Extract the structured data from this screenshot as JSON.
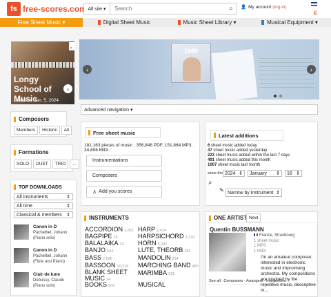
{
  "header": {
    "logo_mark": "fs",
    "logo_text": "free-scores.com",
    "search_scope": "All site ▾",
    "search_placeholder": "Search",
    "account_label": "My account",
    "account_login": "(log-in)",
    "currency": "€"
  },
  "nav": [
    {
      "label": "Free Sheet Music ▾"
    },
    {
      "label": "Digital Sheet Music"
    },
    {
      "label": "Music Sheet Library ▾"
    },
    {
      "label": "Musical Equipment ▾"
    }
  ],
  "ad": {
    "title": "Longy School of Music",
    "deadline": "Deadline: Jan. 5, 2024",
    "badge": "i ✕"
  },
  "carousel": {
    "album_text": "1989"
  },
  "composers": {
    "title": "Composers",
    "buttons": [
      "Members",
      "Historic",
      "All"
    ]
  },
  "formations": {
    "title": "Formations",
    "buttons": [
      "SOLO",
      "DUET",
      "TRIO",
      "..."
    ]
  },
  "top_downloads": {
    "title": "TOP DOWNLOADS",
    "selects": [
      "All instruments",
      "All time",
      "Classical & members"
    ],
    "items": [
      {
        "title": "Canon in D",
        "sub": "Pachelbel, Johann (Piano solo)"
      },
      {
        "title": "Canon in D",
        "sub": "Pachelbel, Johann (Flute and Piano)"
      },
      {
        "title": "Clair de lune",
        "sub": "Debussy, Claude (Piano solo)"
      }
    ]
  },
  "advanced_nav": "Advanced navigation ▾",
  "free_sheet": {
    "title": "Free sheet music",
    "stats_line1": "181,163 pieces of music : 356,848 PDF, 151,864 MP3,",
    "stats_line2": "34,806 MIDI.",
    "buttons": [
      "Instrumentations",
      "Composers",
      "Add you scores"
    ]
  },
  "latest": {
    "title": "Latest additions",
    "lines": [
      {
        "num": "6",
        "text": " sheet music added today"
      },
      {
        "num": "47",
        "text": " sheet music added yesterday"
      },
      {
        "num": "223",
        "text": " sheet music added within the last 7 days"
      },
      {
        "num": "491",
        "text": " sheet music added this month"
      },
      {
        "num": "1007",
        "text": " sheet music last month"
      }
    ],
    "since_label": "since the",
    "year": "2024",
    "month": "January",
    "day": "16",
    "narrow": "Narrow by instrument"
  },
  "instruments": {
    "title": "INSTRUMENTS",
    "left": [
      {
        "name": "ACCORDION",
        "count": "1,051"
      },
      {
        "name": "BAGPIPE",
        "count": "24"
      },
      {
        "name": "BALALAIKA",
        "count": "22"
      },
      {
        "name": "BANJO",
        "count": "634"
      },
      {
        "name": "BASS",
        "count": "2,638"
      },
      {
        "name": "BASSOON",
        "count": "10,310"
      },
      {
        "name": "BLANK SHEET MUSIC",
        "count": "24"
      },
      {
        "name": "BOOKS",
        "count": "502"
      }
    ],
    "right": [
      {
        "name": "HARP",
        "count": "2,414"
      },
      {
        "name": "HARPSICHORD",
        "count": "2,170"
      },
      {
        "name": "HORN",
        "count": "5,292"
      },
      {
        "name": "LUTE, THEORB",
        "count": "283"
      },
      {
        "name": "MANDOLIN",
        "count": "834"
      },
      {
        "name": "MARCHING BAND",
        "count": "480"
      },
      {
        "name": "MARIMBA",
        "count": "331"
      },
      {
        "name": "MUSICAL",
        "count": ""
      }
    ]
  },
  "artist": {
    "title": "ONE ARTIST",
    "next": "Next",
    "name": "Quentin BUSSMANN",
    "location": "France, Strasbourg",
    "stat1": "1 sheet music",
    "stat2": "1 MP3",
    "stat3": "1 MIDI",
    "bio": "I'm an amateur composer, interested in electronic music and improvising orchestra. My compositions are inspired by the repetitive music, descriptive m...",
    "see_all": "See all : Composers - Arrangers - Interpreters"
  },
  "colors": {
    "brand": "#e8522b",
    "accent": "#f39c12",
    "link": "#3a79b5"
  }
}
